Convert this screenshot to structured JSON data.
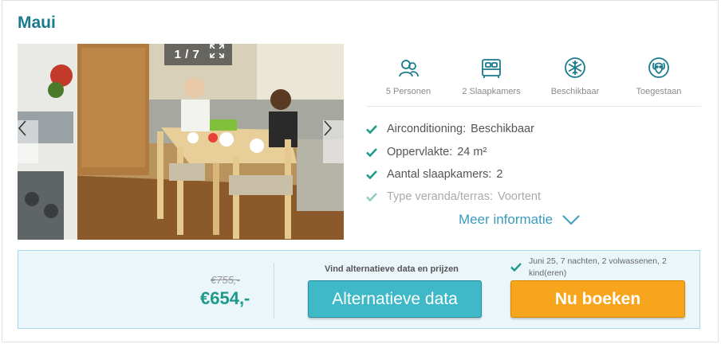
{
  "listing": {
    "title": "Maui"
  },
  "gallery": {
    "counter": "1 / 7",
    "icons": [
      "expand-icon",
      "chevron-left-icon",
      "chevron-right-icon"
    ]
  },
  "amenities": [
    {
      "icon": "persons-icon",
      "label": "5 Personen"
    },
    {
      "icon": "bed-icon",
      "label": "2 Slaapkamers"
    },
    {
      "icon": "snowflake-icon",
      "label": "Beschikbaar"
    },
    {
      "icon": "dog-icon",
      "label": "Toegestaan"
    }
  ],
  "features": [
    {
      "name": "Airconditioning:",
      "value": "Beschikbaar"
    },
    {
      "name": "Oppervlakte:",
      "value": "24 m²"
    },
    {
      "name": "Aantal slaapkamers:",
      "value": "2"
    },
    {
      "name": "Type veranda/terras:",
      "value": "Voortent"
    }
  ],
  "more_info": {
    "label": "Meer informatie"
  },
  "booking": {
    "old_price": "€755,-",
    "new_price": "€654,-",
    "alt_caption": "Vind alternatieve data en prijzen",
    "alt_button": "Alternatieve data",
    "summary": "Juni 25, 7 nachten, 2 volwassenen, 2 kind(eren)",
    "book_button": "Nu boeken"
  },
  "colors": {
    "brand": "#1b7a8c",
    "accent": "#3a9bbc",
    "price": "#1e9a8a",
    "check": "#1e9a8a",
    "alt_button": "#3fb9c8",
    "book_button": "#f8a51e",
    "booking_bg": "#ebf6fb"
  }
}
